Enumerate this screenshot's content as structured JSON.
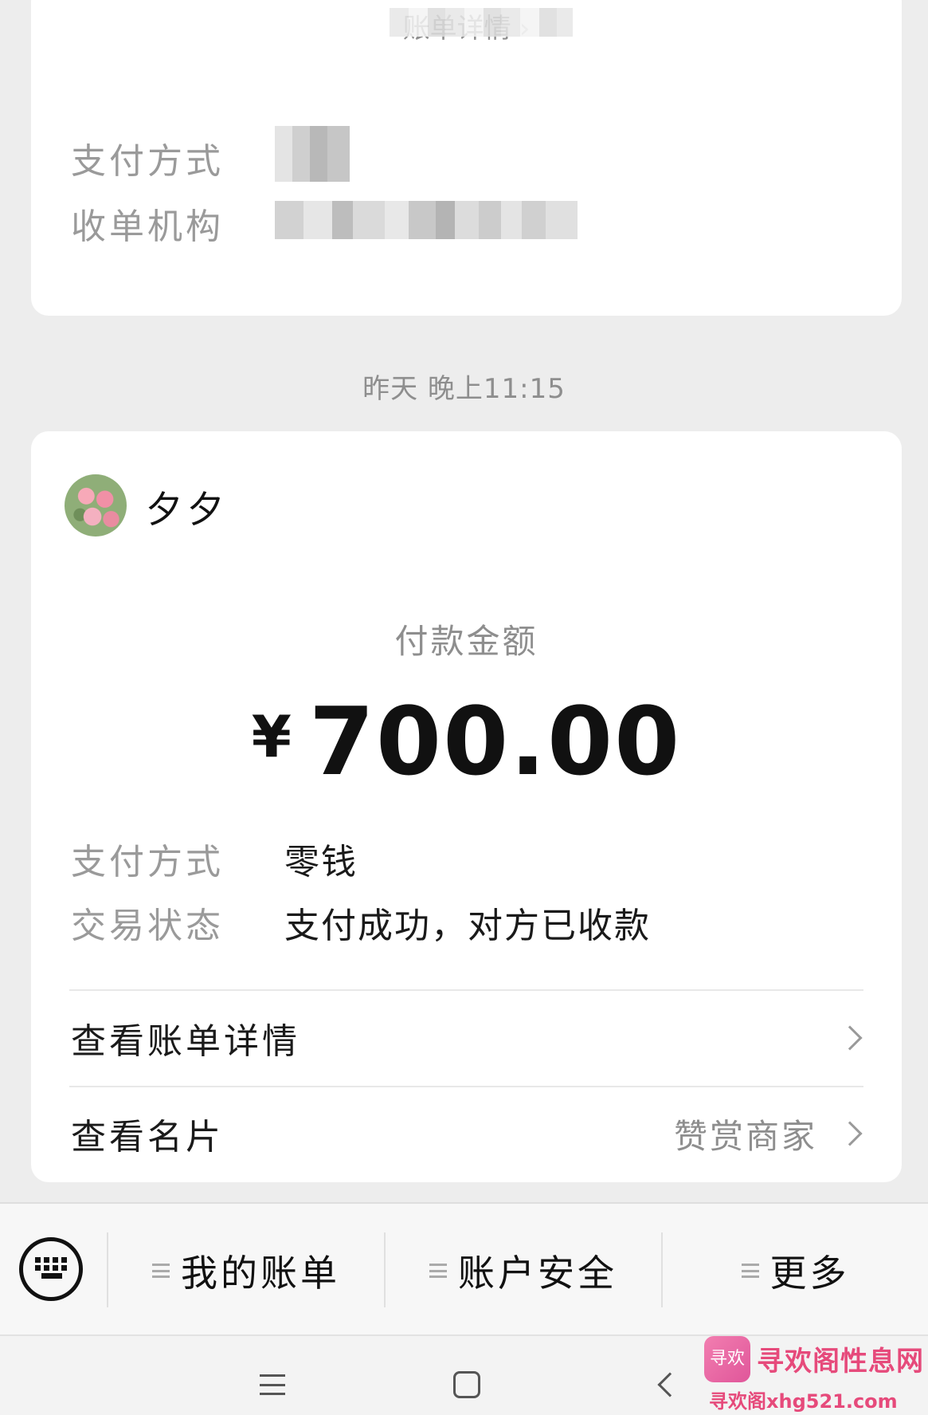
{
  "top_card": {
    "link_label": "账单详情",
    "pay_method_label": "支付方式",
    "acquirer_label": "收单机构"
  },
  "timestamp": "昨天 晚上11:15",
  "payment": {
    "payee_name": "夕夕",
    "amount_label": "付款金额",
    "currency_symbol": "¥",
    "amount": "700.00",
    "pay_method_label": "支付方式",
    "pay_method_value": "零钱",
    "status_label": "交易状态",
    "status_value": "支付成功，对方已收款",
    "bill_detail_link": "查看账单详情",
    "profile_link": "查看名片",
    "profile_sub": "赞赏商家"
  },
  "menu": {
    "items": [
      {
        "label": "我的账单"
      },
      {
        "label": "账户安全"
      },
      {
        "label": "更多"
      }
    ]
  },
  "watermark": {
    "logo_text": "寻欢",
    "title": "寻欢阁性息网",
    "url": "寻欢阁xhg521.com"
  }
}
